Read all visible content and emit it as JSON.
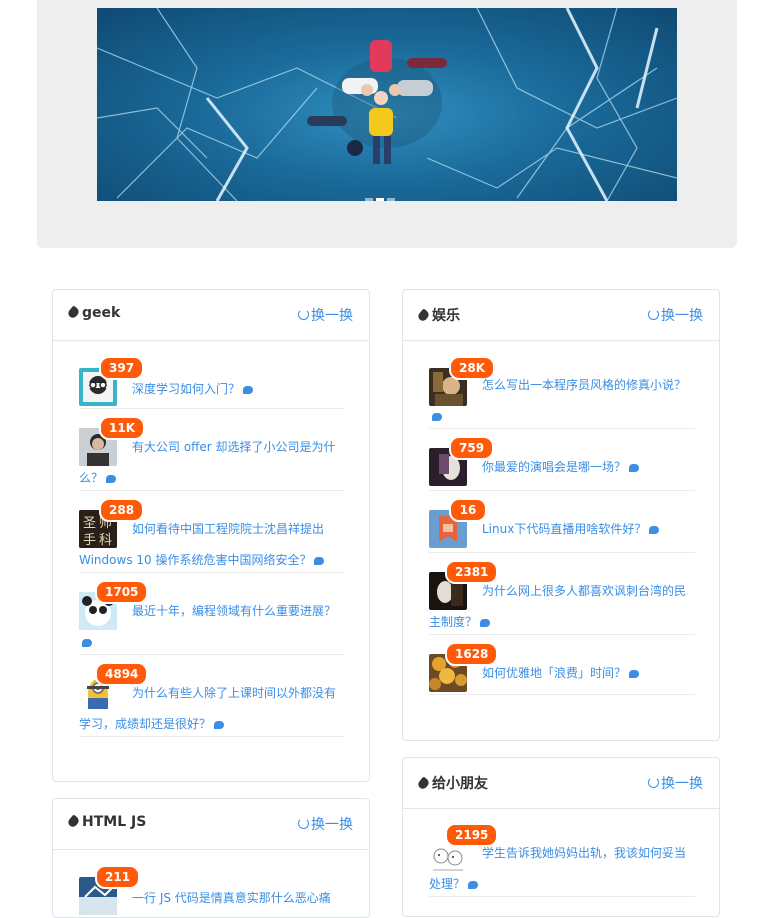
{
  "banner": {
    "image": "people lying on frozen ice lake",
    "slides": 3,
    "active": 1
  },
  "panels": [
    {
      "title": "geek",
      "refresh": "换一换",
      "items": [
        {
          "count": "397",
          "text": "深度学习如何入门？",
          "avatar_color": "#38b3c8"
        },
        {
          "count": "11K",
          "text": "有大公司 offer 却选择了小公司是为什么？",
          "avatar_color": "#9aa5ad"
        },
        {
          "count": "288",
          "text": "如何看待中国工程院院士沈昌祥提出 Windows 10 操作系统危害中国网络安全？",
          "avatar_color": "#3b2b22"
        },
        {
          "count": "1705",
          "text": "最近十年，编程领域有什么重要进展？",
          "avatar_color": "#8fd0e8"
        },
        {
          "count": "4894",
          "text": "为什么有些人除了上课时间以外都没有学习，成绩却还是很好？",
          "avatar_color": "#f2c230"
        }
      ]
    },
    {
      "title": "娱乐",
      "refresh": "换一换",
      "items": [
        {
          "count": "28K",
          "text": "怎么写出一本程序员风格的修真小说？",
          "avatar_color": "#5a4a32"
        },
        {
          "count": "759",
          "text": "你最爱的演唱会是哪一场？",
          "avatar_color": "#4a3a48"
        },
        {
          "count": "16",
          "text": "Linux下代码直播用啥软件好？",
          "avatar_color": "#e26a48"
        },
        {
          "count": "2381",
          "text": "为什么网上很多人都喜欢讽刺台湾的民主制度？",
          "avatar_color": "#3a2a1e"
        },
        {
          "count": "1628",
          "text": "如何优雅地「浪费」时间？",
          "avatar_color": "#c8822e"
        }
      ]
    },
    {
      "title": "给小朋友",
      "refresh": "换一换",
      "items": [
        {
          "count": "2195",
          "text": "学生告诉我她妈妈出轨，我该如何妥当处理？",
          "avatar_color": "#f4f0ec"
        }
      ]
    },
    {
      "title": "HTML JS",
      "refresh": "换一换",
      "items": [
        {
          "count": "211",
          "text": "一行 JS 代码是情真意实那什么恶心痛",
          "avatar_color": "#3a6a9a"
        }
      ]
    }
  ]
}
